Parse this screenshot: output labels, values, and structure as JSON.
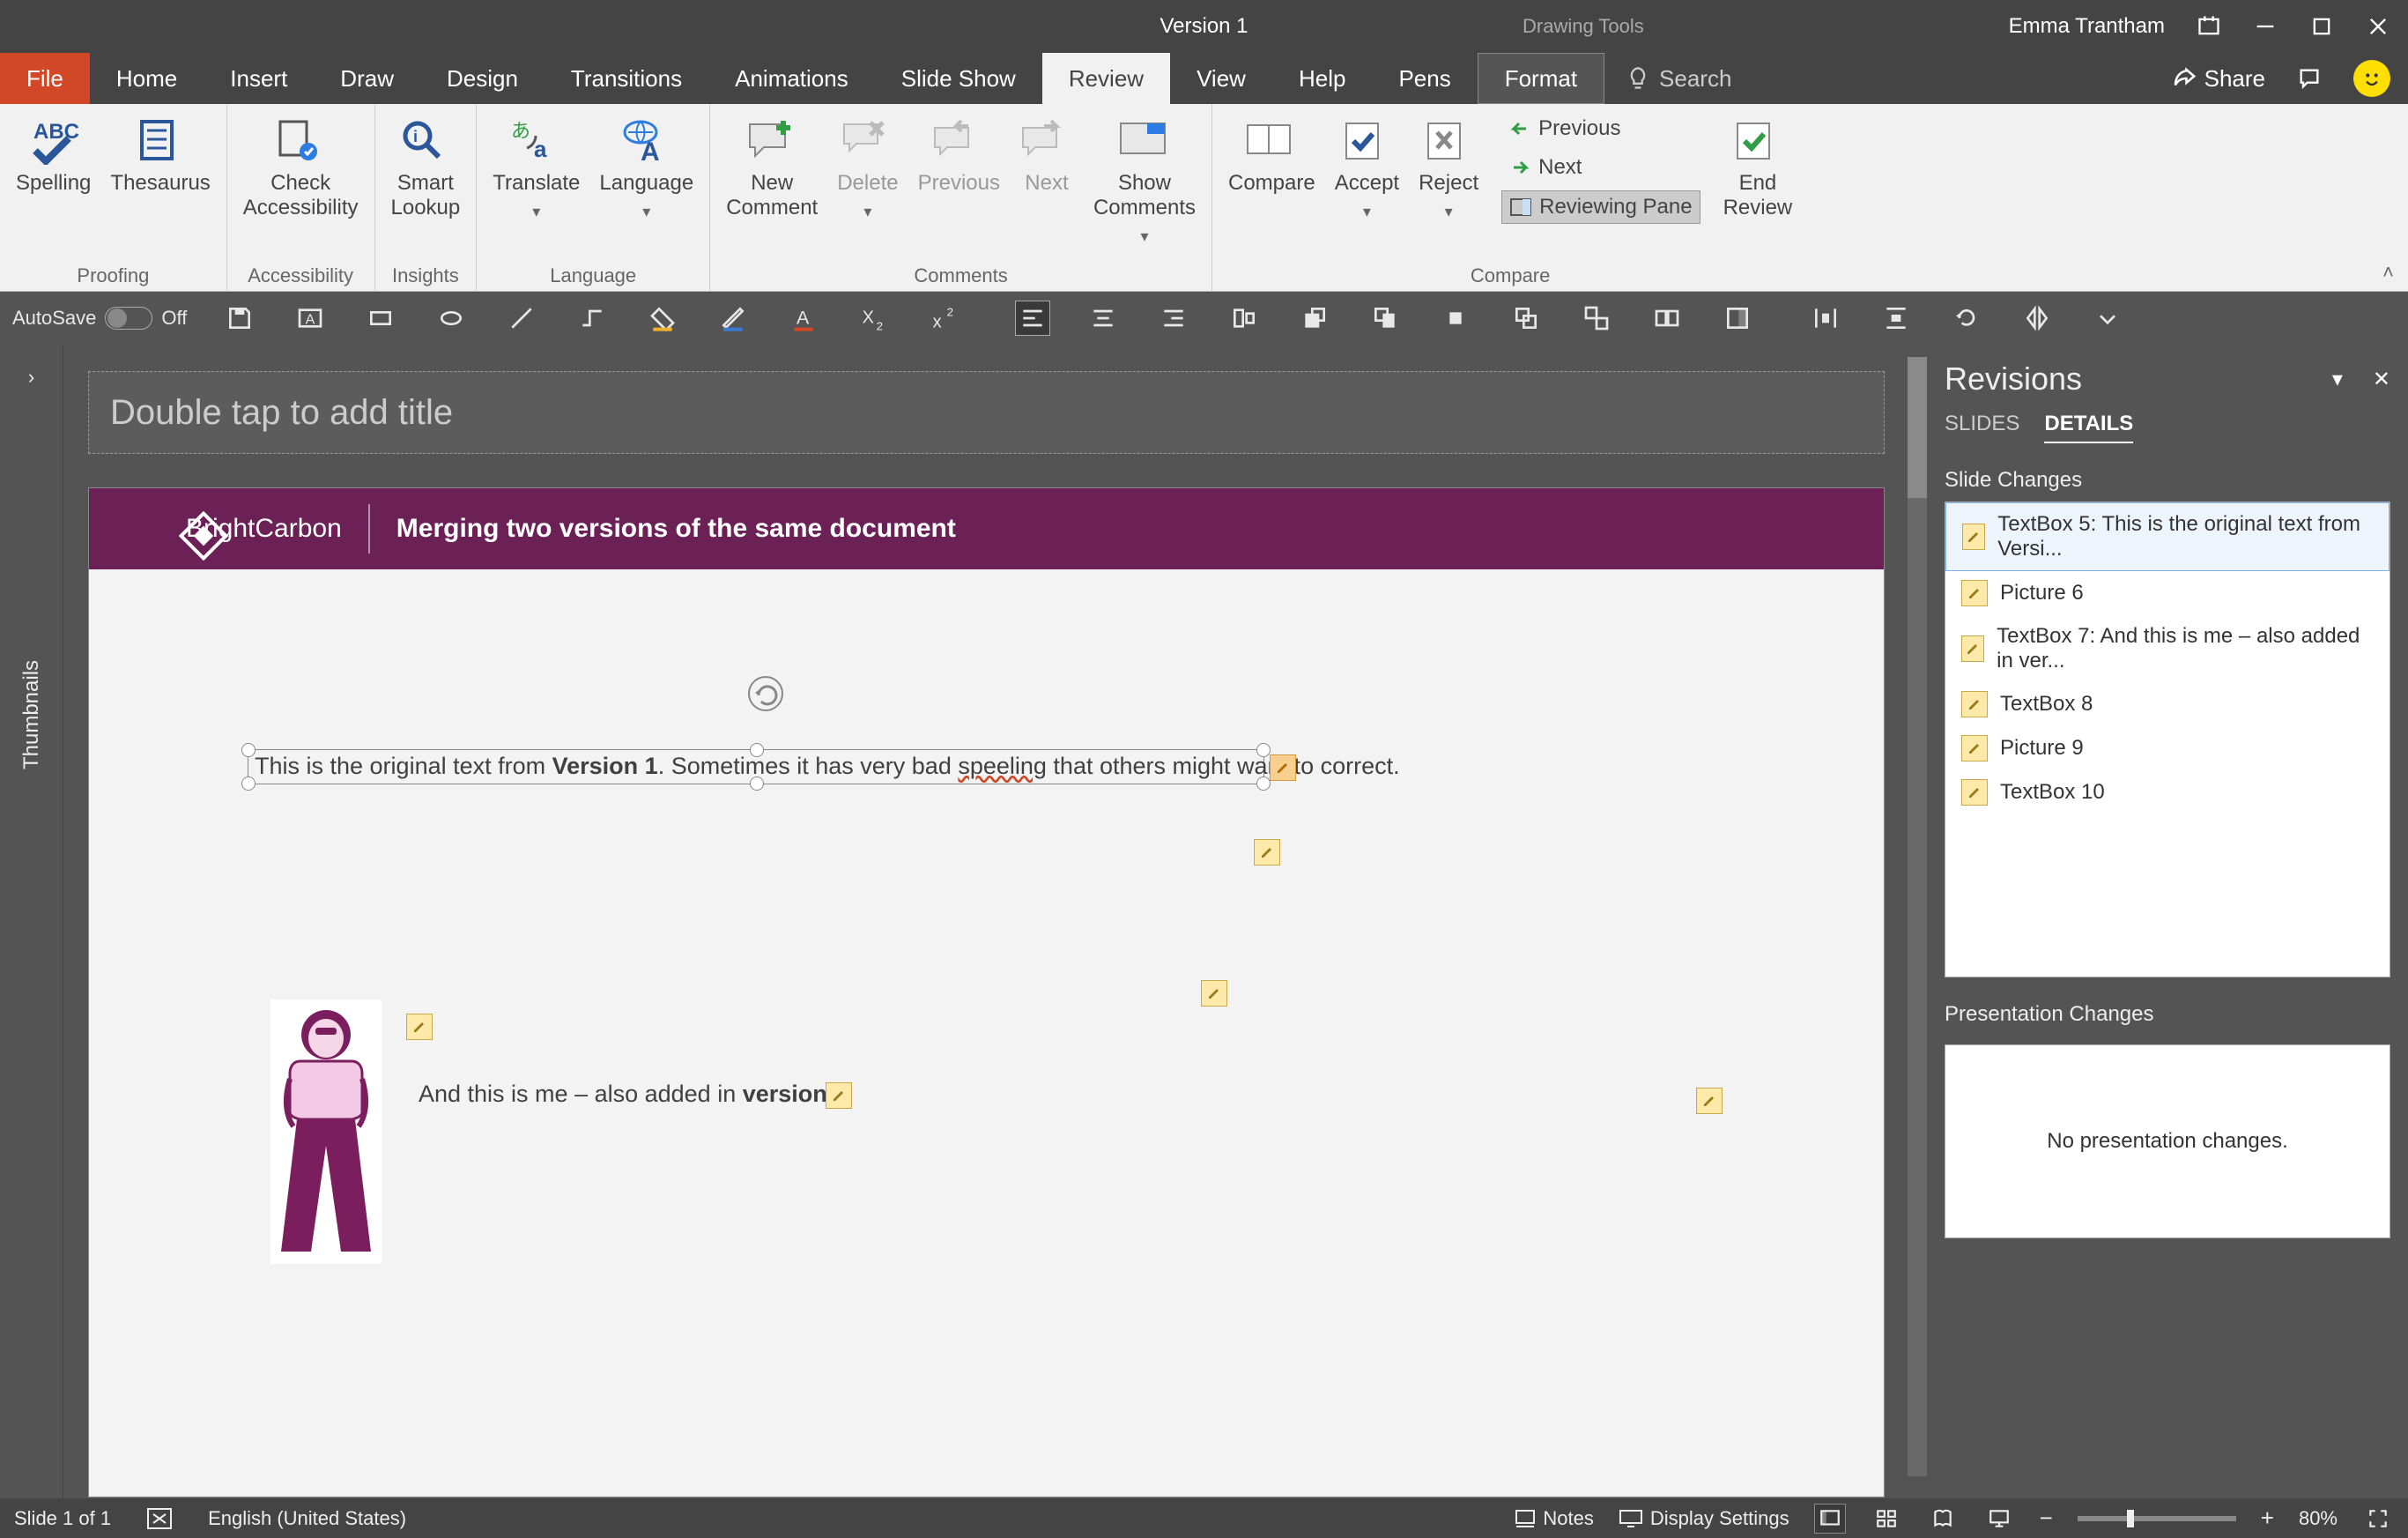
{
  "title_bar": {
    "title": "Version 1",
    "tools_label": "Drawing Tools",
    "user_name": "Emma Trantham"
  },
  "menu": {
    "file": "File",
    "home": "Home",
    "insert": "Insert",
    "draw": "Draw",
    "design": "Design",
    "transitions": "Transitions",
    "animations": "Animations",
    "slideshow": "Slide Show",
    "review": "Review",
    "view": "View",
    "help": "Help",
    "pens": "Pens",
    "format": "Format",
    "search_placeholder": "Search",
    "share": "Share"
  },
  "ribbon": {
    "spelling": "Spelling",
    "thesaurus": "Thesaurus",
    "proofing_group": "Proofing",
    "check_access": "Check\nAccessibility",
    "accessibility_group": "Accessibility",
    "smart_lookup": "Smart\nLookup",
    "insights_group": "Insights",
    "translate": "Translate",
    "language": "Language",
    "language_group": "Language",
    "new_comment": "New\nComment",
    "delete": "Delete",
    "previous": "Previous",
    "next": "Next",
    "show_comments": "Show\nComments",
    "comments_group": "Comments",
    "compare": "Compare",
    "accept": "Accept",
    "reject": "Reject",
    "prev_change": "Previous",
    "next_change": "Next",
    "reviewing_pane": "Reviewing Pane",
    "end_review": "End\nReview",
    "compare_group": "Compare"
  },
  "qat": {
    "autosave": "AutoSave",
    "off": "Off"
  },
  "thumbnails_label": "Thumbnails",
  "title_placeholder": "Double tap to add title",
  "slide": {
    "brand": "BrightCarbon",
    "subtitle": "Merging two versions of the same document",
    "para1_a": "This is the original text from ",
    "para1_b": "Version 1",
    "para1_c": ". Sometimes it has very bad ",
    "para1_d": "speeling",
    "para1_e": " that others might want to correct.",
    "para2_a": "And this is me – also added in ",
    "para2_b": "version 1"
  },
  "rev": {
    "title": "Revisions",
    "tab_slides": "SLIDES",
    "tab_details": "DETAILS",
    "section1": "Slide Changes",
    "items": [
      "TextBox 5: This is the original text from Versi...",
      "Picture 6",
      "TextBox 7: And this is me – also added in ver...",
      "TextBox 8",
      "Picture 9",
      "TextBox 10"
    ],
    "section2": "Presentation Changes",
    "no_changes": "No presentation changes."
  },
  "status": {
    "slide": "Slide 1 of 1",
    "lang": "English (United States)",
    "notes": "Notes",
    "display": "Display Settings",
    "zoom": "80%"
  }
}
